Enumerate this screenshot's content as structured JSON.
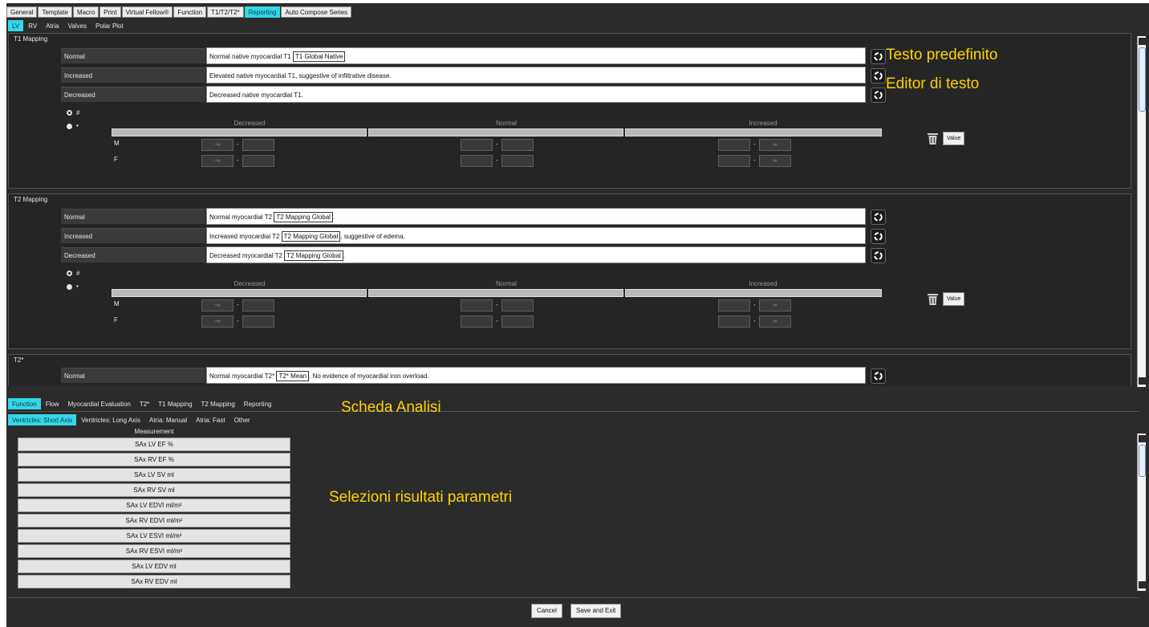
{
  "top_tabs": [
    "General",
    "Template",
    "Macro",
    "Print",
    "Virtual Fellow®",
    "Function",
    "T1/T2/T2*",
    "Reporting",
    "Auto Compose Series"
  ],
  "top_tabs_active": "Reporting",
  "sub_tabs": [
    "LV",
    "RV",
    "Atria",
    "Valves",
    "Polar Plot"
  ],
  "sub_tabs_active": "LV",
  "sections": {
    "t1": {
      "title": "T1 Mapping",
      "rows": [
        {
          "label": "Normal",
          "before": "Normal native myocardial T1 ",
          "tag": "T1 Global Native",
          "after": ""
        },
        {
          "label": "Increased",
          "before": "Elevated native myocardial T1, suggestive of infiltrative disease.",
          "tag": "",
          "after": ""
        },
        {
          "label": "Decreased",
          "before": "Decreased native myocardial T1.",
          "tag": "",
          "after": ""
        }
      ]
    },
    "t2": {
      "title": "T2 Mapping",
      "rows": [
        {
          "label": "Normal",
          "before": "Normal myocardial T2 ",
          "tag": "T2 Mapping Global",
          "after": "."
        },
        {
          "label": "Increased",
          "before": "Increased myocardial T2 ",
          "tag": "T2 Mapping Global",
          "after": ", suggestive of edema."
        },
        {
          "label": "Decreased",
          "before": "Decreased myocardial T2 ",
          "tag": "T2 Mapping Global",
          "after": "."
        }
      ]
    },
    "t2star": {
      "title": "T2*",
      "rows": [
        {
          "label": "Normal",
          "before": "Normal myocardial T2* ",
          "tag": "T2* Mean",
          "after": ". No evidence of myocardial iron overload."
        }
      ]
    }
  },
  "thresholds": {
    "radio_hash": "#",
    "radio_dot": "•",
    "range_labels": [
      "Decreased",
      "Normal",
      "Increased"
    ],
    "sex_labels": [
      "M",
      "F"
    ],
    "neg_inf": "-∞",
    "pos_inf": "∞",
    "dash": "-",
    "value_button": "Value"
  },
  "analysis_tabs": [
    "Function",
    "Flow",
    "Myocardial Evaluation",
    "T2*",
    "T1 Mapping",
    "T2 Mapping",
    "Reporting"
  ],
  "analysis_tabs_active": "Function",
  "analysis_sub_tabs": [
    "Ventricles: Short Axis",
    "Ventricles: Long Axis",
    "Atria: Manual",
    "Atria: Fast",
    "Other"
  ],
  "analysis_sub_tabs_active": "Ventricles: Short Axis",
  "measurement_header": "Measurement",
  "measurements": [
    "SAx LV EF %",
    "SAx RV EF %",
    "SAx LV SV ml",
    "SAx RV SV ml",
    "SAx LV EDVI ml/m²",
    "SAx RV EDVI ml/m²",
    "SAx LV ESVI ml/m²",
    "SAx RV ESVI ml/m²",
    "SAx LV EDV ml",
    "SAx RV EDV ml"
  ],
  "annotations": {
    "testo_predefinito": "Testo predefinito",
    "editor_di_testo": "Editor di testo",
    "scheda_analisi": "Scheda Analisi",
    "selezioni": "Selezioni risultati parametri"
  },
  "buttons": {
    "cancel": "Cancel",
    "save_exit": "Save and Exit"
  },
  "colors": {
    "accent": "#35d6e6",
    "annotation": "#ffd400",
    "background": "#2b2b2b"
  }
}
